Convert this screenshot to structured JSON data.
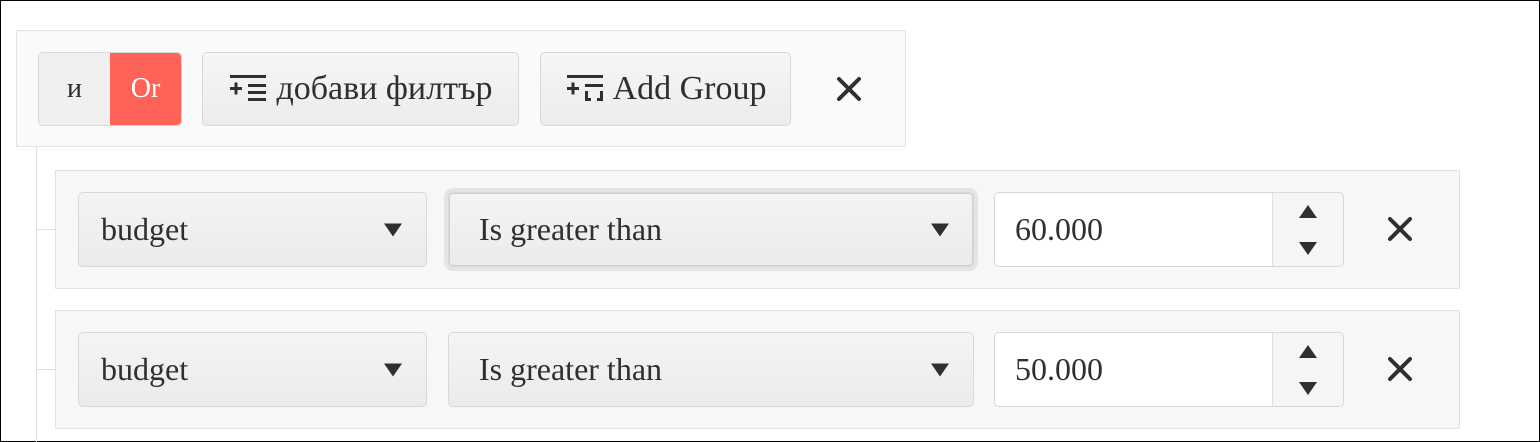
{
  "toolbar": {
    "logic_and_label": "и",
    "logic_or_label": "Or",
    "logic_or_active_color": "#ff6358",
    "add_filter_label": "добави филтър",
    "add_filter_icon": "add-filter-icon",
    "add_group_label": "Add Group",
    "add_group_icon": "add-group-icon",
    "remove_icon": "close-icon"
  },
  "filters": [
    {
      "field": "budget",
      "operator": "Is greater than",
      "value": "60.000",
      "operator_focused": true
    },
    {
      "field": "budget",
      "operator": "Is greater than",
      "value": "50.000",
      "operator_focused": false
    }
  ]
}
